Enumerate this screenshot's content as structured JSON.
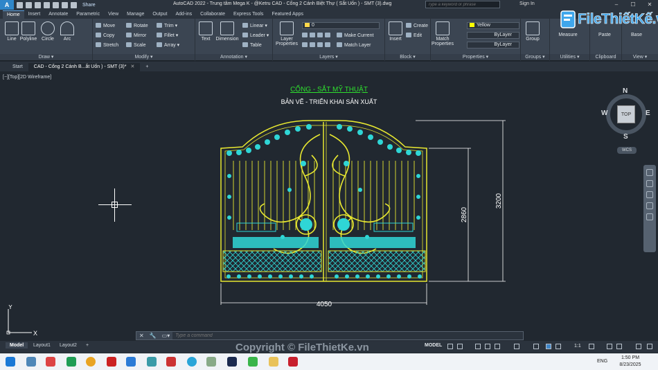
{
  "titlebar": {
    "app_logo": "A",
    "share": "Share",
    "title": "AutoCAD 2022 - Trung tâm Mega K - @Ketru    CAD - Cổng 2 Cánh Biệt Thự ( Sắt Uốn ) - SMT (3).dwg",
    "search_placeholder": "Type a keyword or phrase",
    "signin": "Sign In"
  },
  "ribbon_tabs": [
    "Home",
    "Insert",
    "Annotate",
    "Parametric",
    "View",
    "Manage",
    "Output",
    "Add-ins",
    "Collaborate",
    "Express Tools",
    "Featured Apps"
  ],
  "ribbon": {
    "draw": {
      "label": "Draw ▾",
      "line": "Line",
      "polyline": "Polyline",
      "circle": "Circle",
      "arc": "Arc"
    },
    "modify": {
      "label": "Modify ▾",
      "move": "Move",
      "rotate": "Rotate",
      "trim": "Trim ▾",
      "copy": "Copy",
      "mirror": "Mirror",
      "fillet": "Fillet ▾",
      "stretch": "Stretch",
      "scale": "Scale",
      "array": "Array ▾"
    },
    "annotation": {
      "label": "Annotation ▾",
      "text": "Text",
      "dimension": "Dimension",
      "linear": "Linear ▾",
      "leader": "Leader ▾",
      "table": "Table"
    },
    "layers": {
      "label": "Layers ▾",
      "layer_properties": "Layer Properties",
      "layer_value": "0",
      "make_current": "Make Current",
      "match_layer": "Match Layer"
    },
    "block": {
      "label": "Block ▾",
      "insert": "Insert",
      "create": "Create",
      "edit": "Edit"
    },
    "properties": {
      "label": "Properties ▾",
      "match_properties": "Match Properties",
      "color": "Yellow",
      "linetype": "ByLayer",
      "lineweight": "ByLayer"
    },
    "groups": {
      "label": "Groups ▾",
      "group": "Group"
    },
    "utilities": {
      "label": "Utilities ▾",
      "measure": "Measure"
    },
    "clipboard": {
      "label": "Clipboard",
      "paste": "Paste"
    },
    "view": {
      "label": "View ▾",
      "base": "Base"
    }
  },
  "brand": {
    "text": "FileThiếtKế.vn"
  },
  "file_tabs": [
    {
      "label": "Start"
    },
    {
      "label": "CAD - Cổng 2 Cánh B...ắt Uốn ) - SMT (3)*"
    }
  ],
  "viewport": {
    "label": "[−][Top][2D Wireframe]",
    "drawing_title": "CỔNG - SẮT MỸ THUẬT",
    "drawing_subtitle": "BẢN VẼ - TRIỂN KHAI SẢN XUẤT",
    "dim_width": "4050",
    "dim_height_inner": "2860",
    "dim_height_outer": "3200",
    "viewcube": {
      "n": "N",
      "s": "S",
      "e": "E",
      "w": "W",
      "top": "TOP",
      "wcs": "WCS"
    },
    "ucs": {
      "x": "X",
      "y": "Y"
    }
  },
  "colors": {
    "gate_frame": "#e8e830",
    "gate_ornament": "#2fd6d6",
    "dimension": "#ffffff",
    "title": "#2ee02e"
  },
  "command": {
    "placeholder": "Type a command"
  },
  "layout_tabs": [
    "Model",
    "Layout1",
    "Layout2"
  ],
  "status": {
    "model": "MODEL",
    "scale": "1:1",
    "copyright": "Copyright © FileThietKe.vn"
  },
  "taskbar": {
    "lang": "ENG",
    "time": "1:50 PM",
    "date": "8/23/2025"
  }
}
